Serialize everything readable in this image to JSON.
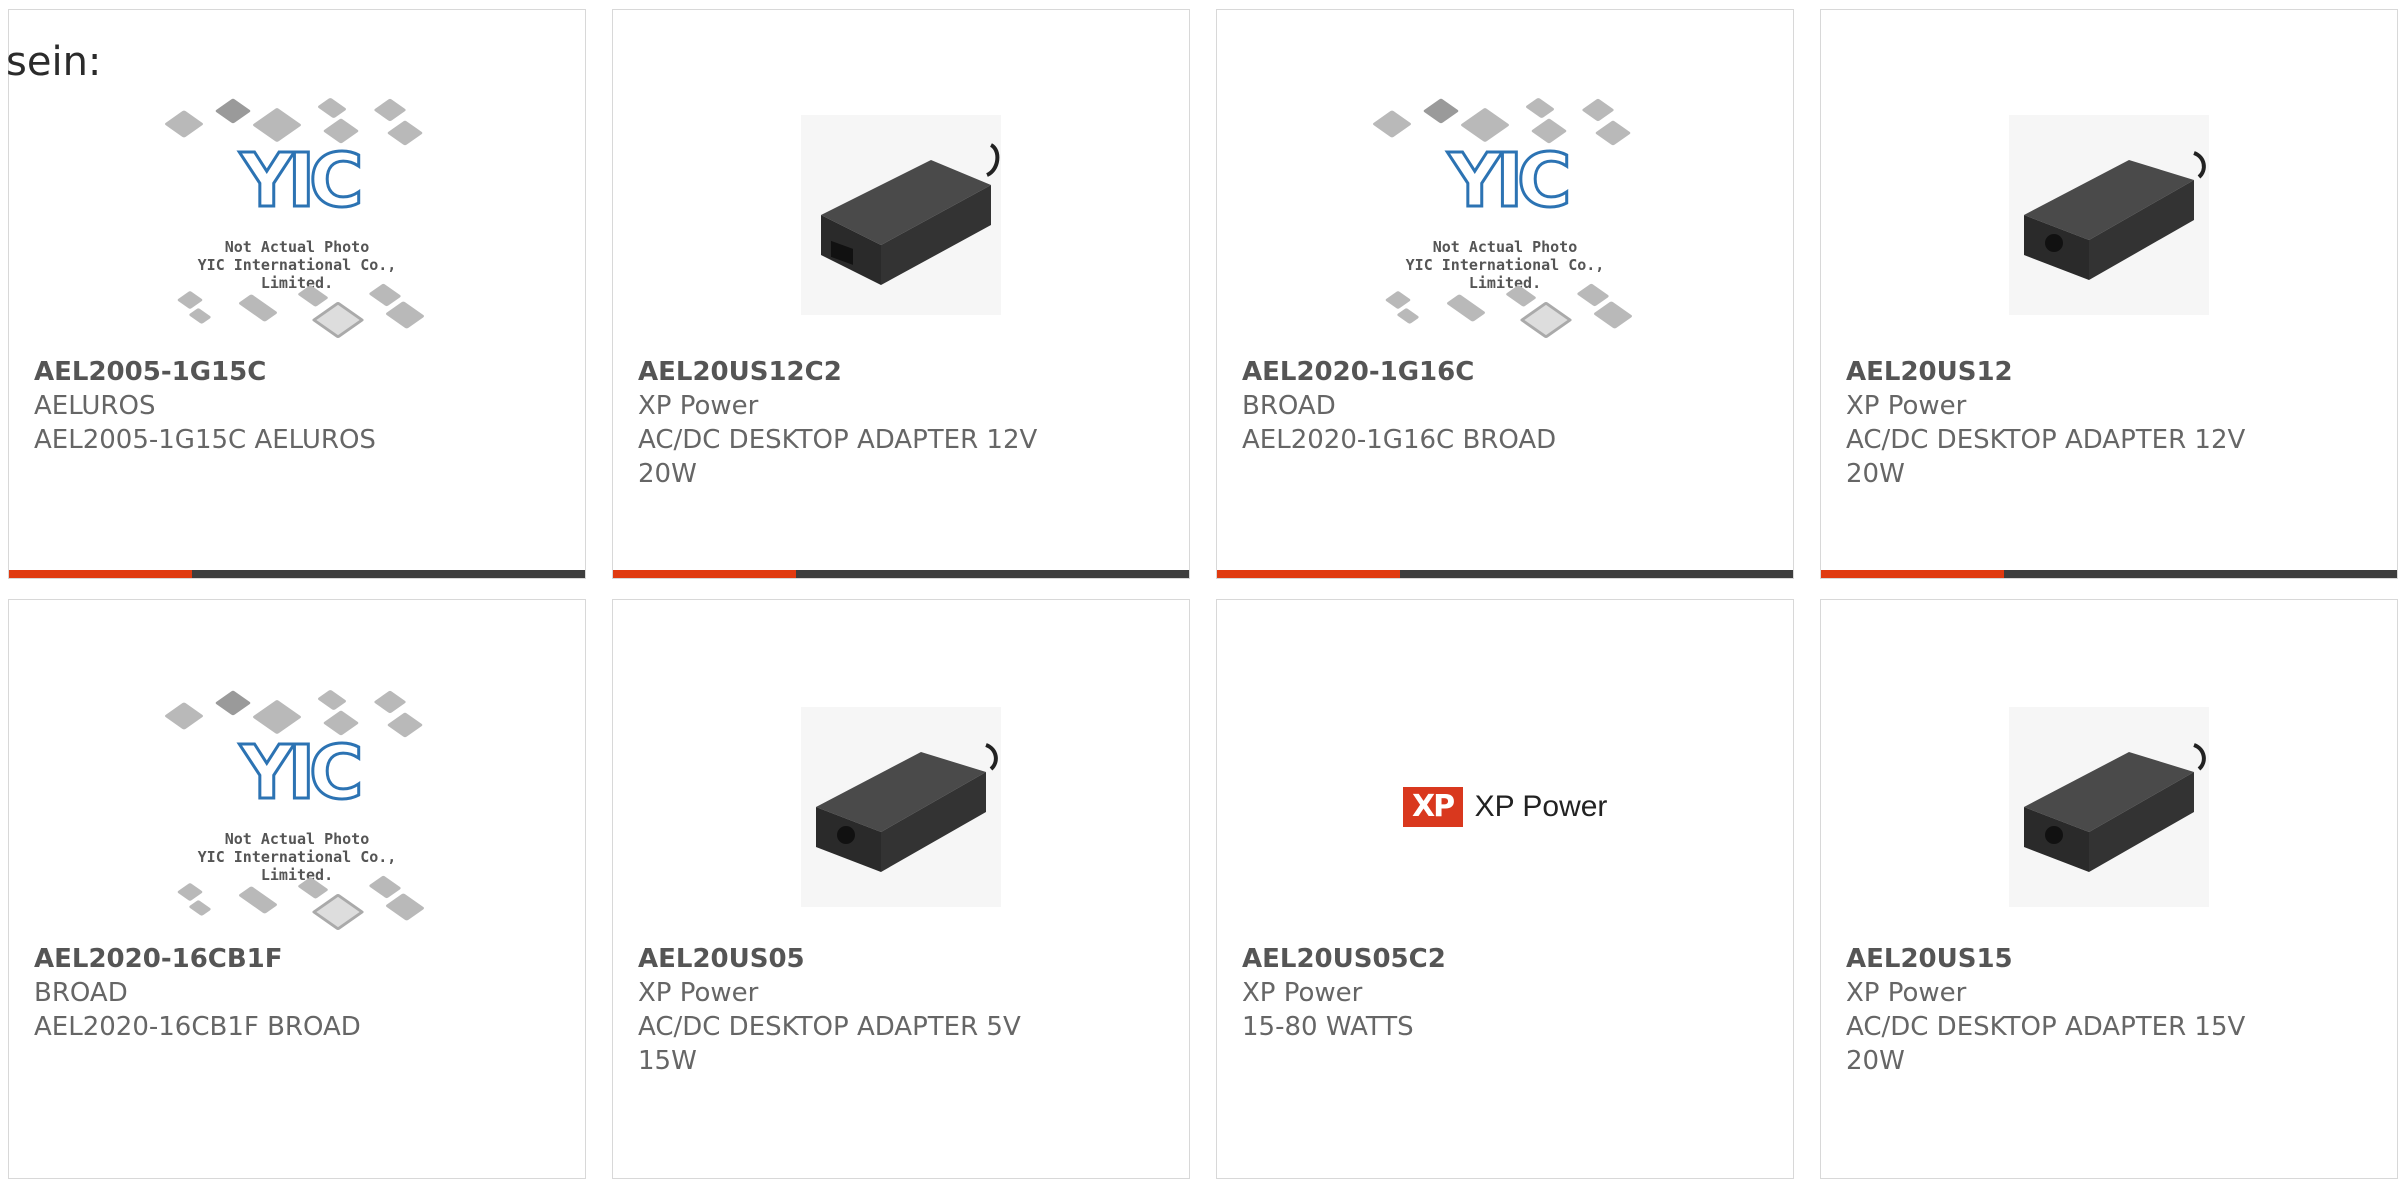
{
  "page": {
    "heading": "sein:"
  },
  "products": [
    {
      "part": "AEL2005-1G15C",
      "maker": "AELUROS",
      "desc": "AEL2005-1G15C AELUROS",
      "image": "placeholder",
      "placeholder_caption": [
        "Not Actual Photo",
        "YIC International Co., Limited."
      ]
    },
    {
      "part": "AEL20US12C2",
      "maker": "XP Power",
      "desc": "AC/DC DESKTOP ADAPTER 12V 20W",
      "image": "adapter"
    },
    {
      "part": "AEL2020-1G16C",
      "maker": "BROAD",
      "desc": "AEL2020-1G16C BROAD",
      "image": "placeholder",
      "placeholder_caption": [
        "Not Actual Photo",
        "YIC International Co., Limited."
      ]
    },
    {
      "part": "AEL20US12",
      "maker": "XP Power",
      "desc": "AC/DC DESKTOP ADAPTER 12V 20W",
      "image": "adapter"
    },
    {
      "part": "AEL2020-16CB1F",
      "maker": "BROAD",
      "desc": "AEL2020-16CB1F BROAD",
      "image": "placeholder",
      "placeholder_caption": [
        "Not Actual Photo",
        "YIC International Co., Limited."
      ]
    },
    {
      "part": "AEL20US05",
      "maker": "XP Power",
      "desc": "AC/DC DESKTOP ADAPTER 5V 15W",
      "image": "adapter"
    },
    {
      "part": "AEL20US05C2",
      "maker": "XP Power",
      "desc": "15-80 WATTS",
      "image": "xp-logo",
      "logo_mark": "XP",
      "logo_text": "XP Power"
    },
    {
      "part": "AEL20US15",
      "maker": "XP Power",
      "desc": "AC/DC DESKTOP ADAPTER 15V 20W",
      "image": "adapter"
    }
  ],
  "placeholder_logo": "YIC",
  "colors": {
    "accent": "#e03a10",
    "bar": "#3d3d3d",
    "yic_blue": "#2c73b3",
    "xp_red": "#d9381e"
  }
}
